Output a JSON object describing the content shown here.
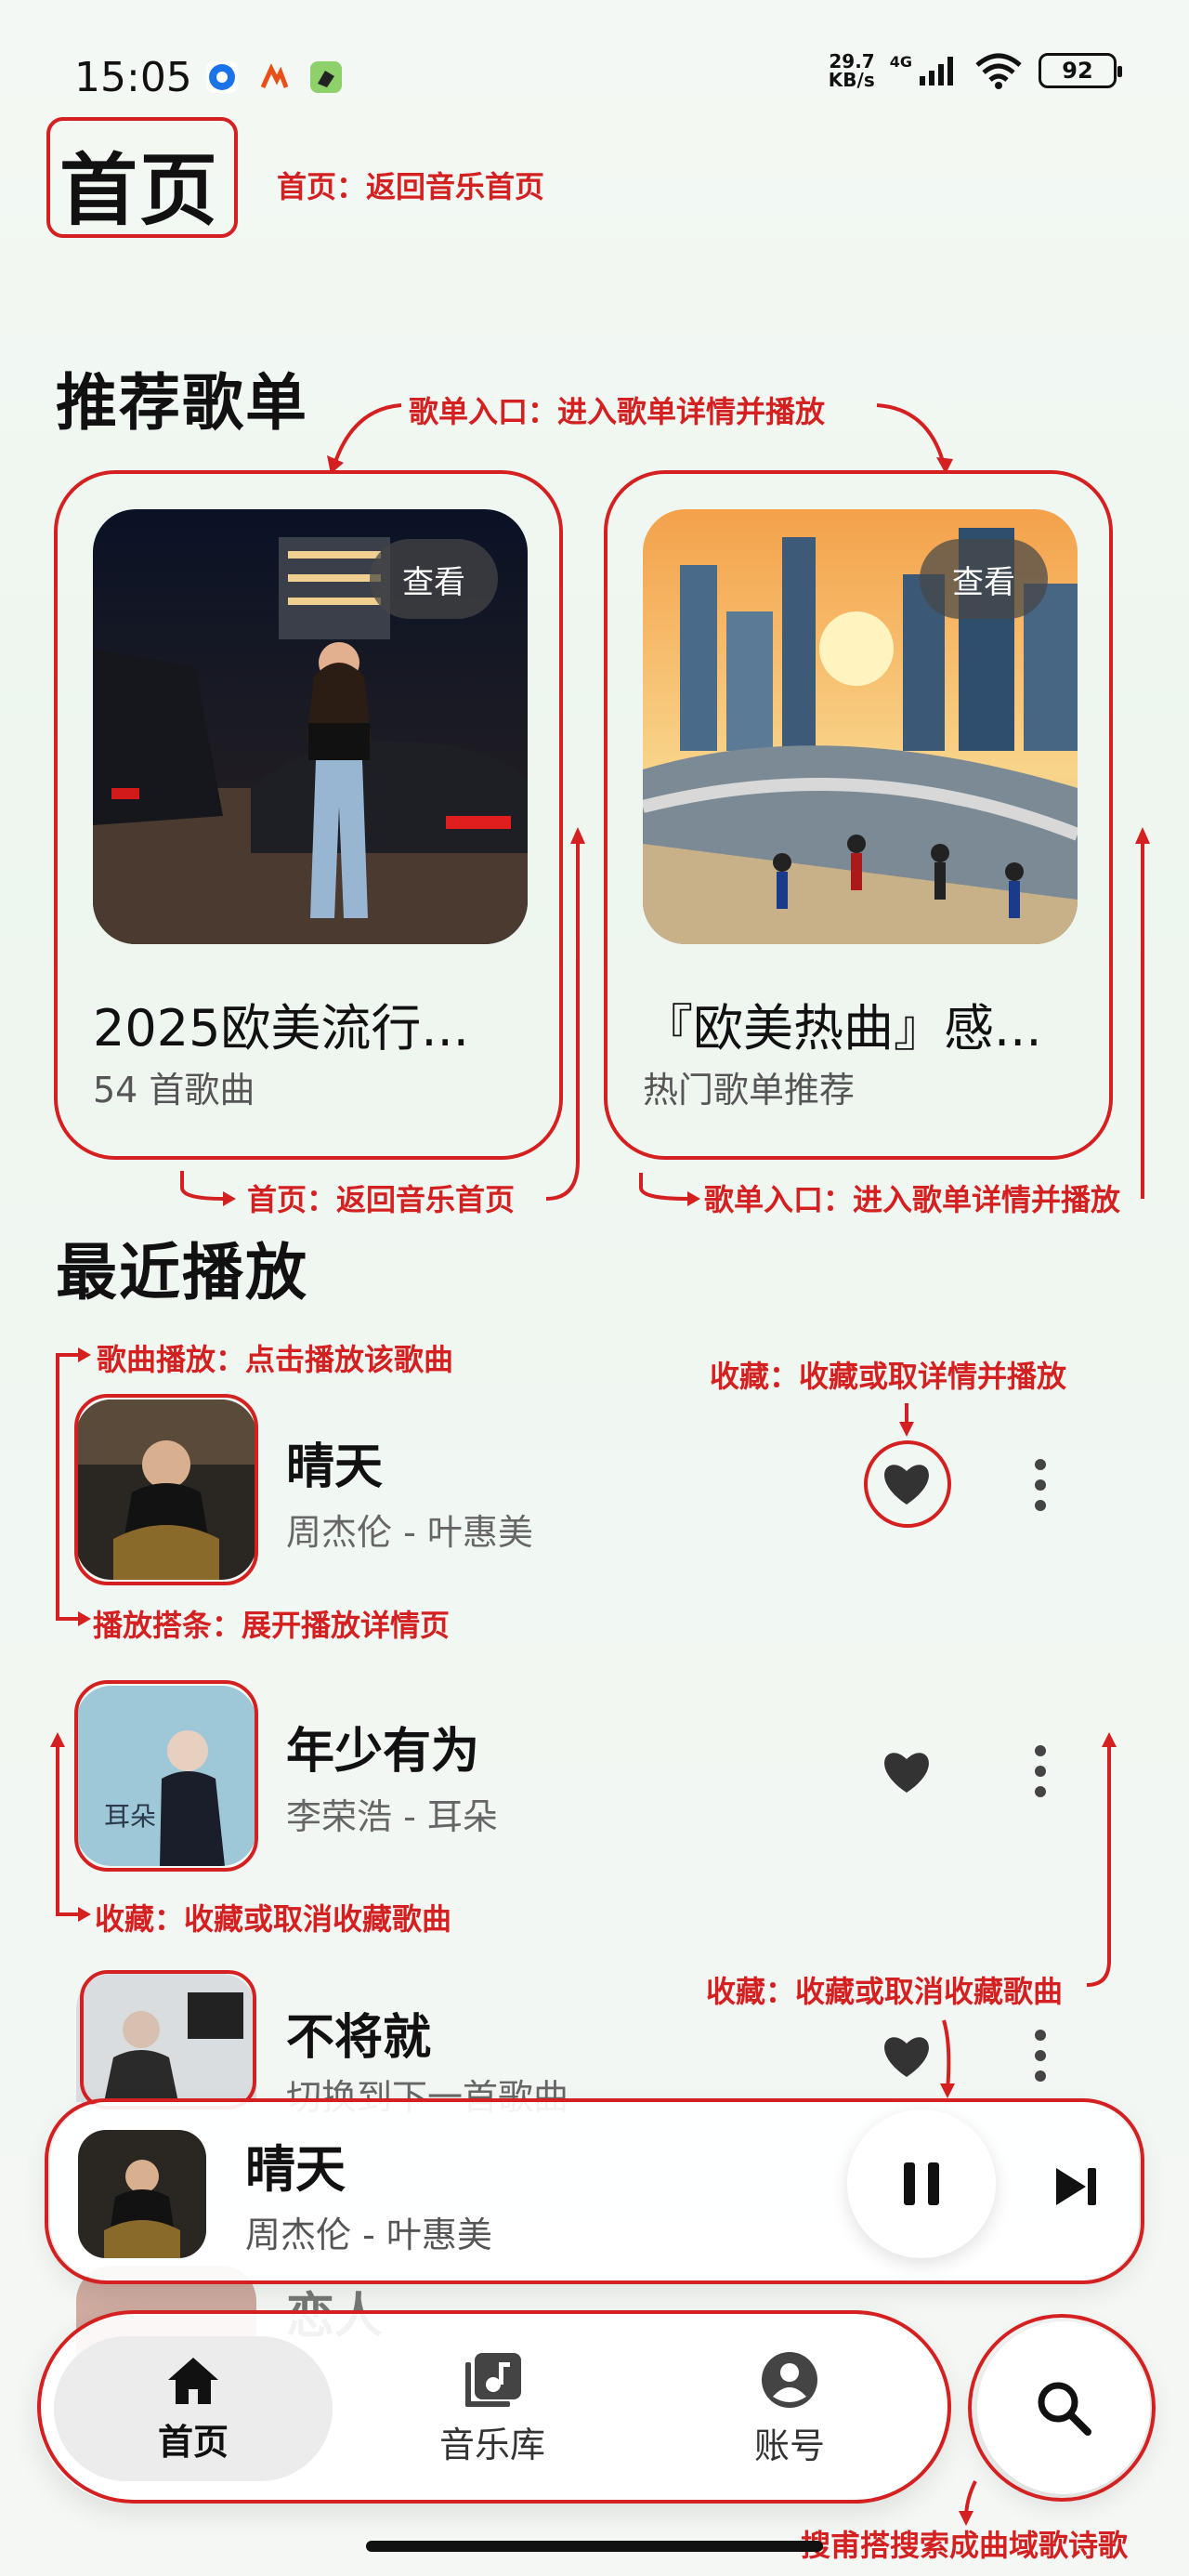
{
  "status_bar": {
    "time": "15:05",
    "net_speed_value": "29.7",
    "net_speed_unit": "KB/s",
    "network": "4G",
    "battery": "92"
  },
  "page_title": "首页",
  "sections": {
    "recommended": "推荐歌单",
    "recent": "最近播放"
  },
  "playlists": [
    {
      "view_label": "查看",
      "title": "2025欧美流行...",
      "subtitle": "54 首歌曲"
    },
    {
      "view_label": "查看",
      "title": "『欧美热曲』感...",
      "subtitle": "热门歌单推荐"
    }
  ],
  "songs": [
    {
      "title": "晴天",
      "subtitle": "周杰伦 - 叶惠美"
    },
    {
      "title": "年少有为",
      "subtitle": "李荣浩 - 耳朵"
    },
    {
      "title": "不将就",
      "subtitle": "切换到下一首歌曲"
    },
    {
      "title": "恋人",
      "subtitle": ""
    }
  ],
  "mini_player": {
    "title": "晴天",
    "subtitle": "周杰伦 - 叶惠美",
    "state": "playing"
  },
  "bottom_nav": [
    {
      "label": "首页",
      "icon": "home-icon",
      "active": true
    },
    {
      "label": "音乐库",
      "icon": "music-library-icon",
      "active": false
    },
    {
      "label": "账号",
      "icon": "account-icon",
      "active": false
    }
  ],
  "annotations": {
    "title": "首页：返回音乐首页",
    "playlist_entry_top": "歌单入口：进入歌单详情并播放",
    "card1_bottom": "首页：返回音乐首页",
    "card2_bottom": "歌单入口：进入歌单详情并播放",
    "song_play": "歌曲播放：点击播放该歌曲",
    "favorite_detail": "收藏：收藏或取详情并播放",
    "player_bar": "播放搭条：展开播放详情页",
    "favorite_left": "收藏：收藏或取消收藏歌曲",
    "favorite_right": "收藏：收藏或取消收藏歌曲",
    "search": "搜甫搭搜索成曲域歌诗歌"
  },
  "colors": {
    "annotation": "#d42020",
    "accent_dark": "#111111"
  }
}
